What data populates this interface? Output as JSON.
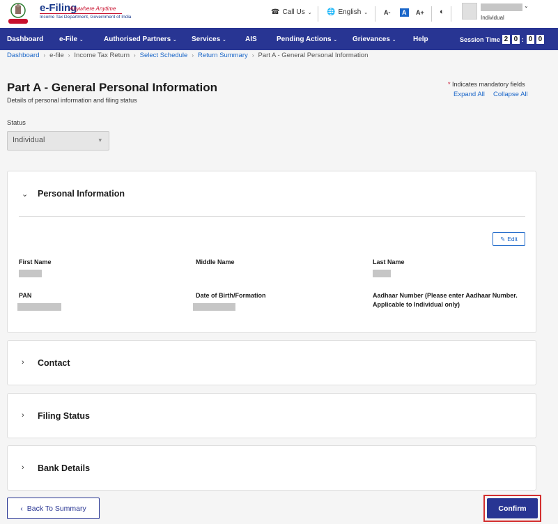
{
  "header": {
    "brand": "e-Filing",
    "tagline": "Anywhere Anytime",
    "dept": "Income Tax Department, Government of India",
    "call_us": "Call Us",
    "language": "English",
    "font_decrease": "A-",
    "font_normal": "A",
    "font_increase": "A+",
    "user_role": "Individual"
  },
  "nav": {
    "items": [
      "Dashboard",
      "e-File",
      "Authorised Partners",
      "Services",
      "AIS",
      "Pending Actions",
      "Grievances",
      "Help"
    ],
    "session_label": "Session Time",
    "session_digits": [
      "2",
      "0",
      "0",
      "0"
    ]
  },
  "breadcrumb": {
    "items": [
      "Dashboard",
      "e-file",
      "Income Tax Return",
      "Select Schedule",
      "Return Summary",
      "Part A - General Personal Information"
    ]
  },
  "page": {
    "title": "Part A - General Personal Information",
    "subtitle": "Details of personal information and filing status",
    "mandatory_note": "Indicates mandatory fields",
    "expand_all": "Expand All",
    "collapse_all": "Collapse All",
    "status_label": "Status",
    "status_value": "Individual"
  },
  "personal": {
    "title": "Personal Information",
    "edit": "Edit",
    "first_name": "First Name",
    "middle_name": "Middle Name",
    "last_name": "Last Name",
    "pan": "PAN",
    "dob": "Date of Birth/Formation",
    "aadhaar": "Aadhaar Number (Please enter Aadhaar Number. Applicable to Individual only)"
  },
  "sections": {
    "contact": "Contact",
    "filing_status": "Filing Status",
    "bank_details": "Bank Details"
  },
  "footer": {
    "back": "Back To Summary",
    "confirm": "Confirm"
  },
  "colors": {
    "nav_bg": "#283593",
    "link": "#1a66c9",
    "highlight": "#d32f2f"
  }
}
